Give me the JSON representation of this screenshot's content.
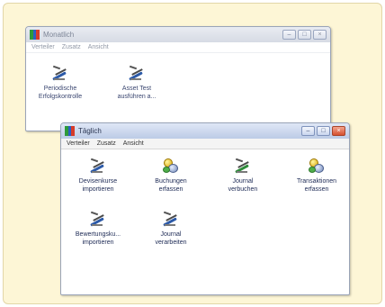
{
  "back_window": {
    "title": "Monatlich",
    "menu": [
      "Verteiler",
      "Zusatz",
      "Ansicht"
    ],
    "items": [
      {
        "label_line1": "Periodische",
        "label_line2": "Erfolgskontrolle",
        "icon": "journal-pen-icon"
      },
      {
        "label_line1": "Asset Test",
        "label_line2": "ausführen a...",
        "icon": "journal-pen-icon"
      }
    ]
  },
  "front_window": {
    "title": "Täglich",
    "menu": [
      "Verteiler",
      "Zusatz",
      "Ansicht"
    ],
    "items": [
      {
        "label_line1": "Devisenkurse",
        "label_line2": "importieren",
        "icon": "journal-pen-icon"
      },
      {
        "label_line1": "Buchungen",
        "label_line2": "erfassen",
        "icon": "coin-stack-icon"
      },
      {
        "label_line1": "Journal",
        "label_line2": "verbuchen",
        "icon": "journal-pen-green-icon"
      },
      {
        "label_line1": "Transaktionen",
        "label_line2": "erfassen",
        "icon": "coin-stack-icon"
      },
      {
        "label_line1": "Bewertungsku...",
        "label_line2": "importieren",
        "icon": "journal-pen-icon"
      },
      {
        "label_line1": "Journal",
        "label_line2": "verarbeiten",
        "icon": "journal-pen-icon"
      }
    ]
  },
  "window_buttons": {
    "minimize": "–",
    "maximize": "□",
    "close": "×"
  }
}
